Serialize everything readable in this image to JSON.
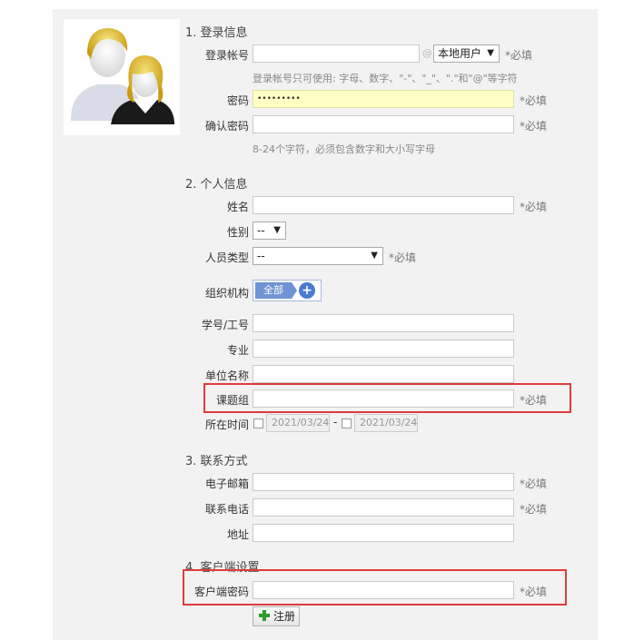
{
  "sections": {
    "login": "1. 登录信息",
    "personal": "2. 个人信息",
    "contact": "3. 联系方式",
    "client": "4. 客户端设置"
  },
  "login": {
    "account_label": "登录帐号",
    "at_symbol": "@",
    "domain_select": "本地用户",
    "account_hint": "登录帐号只可使用: 字母、数字、\"-\"、\"_\"、\".\"和\"@\"等字符",
    "password_label": "密码",
    "password_value": "•••••••••",
    "confirm_label": "确认密码",
    "password_hint": "8-24个字符，必须包含数字和大小写字母"
  },
  "personal": {
    "name_label": "姓名",
    "gender_label": "性别",
    "gender_value": "--",
    "type_label": "人员类型",
    "type_value": "--",
    "org_label": "组织机构",
    "org_all": "全部",
    "id_label": "学号/工号",
    "major_label": "专业",
    "unit_label": "单位名称",
    "group_label": "课题组",
    "time_label": "所在时间",
    "date_from": "2021/03/24",
    "date_sep": "-",
    "date_to": "2021/03/24"
  },
  "contact": {
    "email_label": "电子邮箱",
    "phone_label": "联系电话",
    "address_label": "地址"
  },
  "client": {
    "password_label": "客户端密码"
  },
  "required": "*必填",
  "register_button": "注册",
  "colors": {
    "highlight_border": "#e03a3a",
    "password_bg": "#ffffc4",
    "org_blue": "#6f93d4"
  },
  "icons": [
    "users-avatar-icon",
    "chevron-down-icon",
    "plus-circle-icon",
    "green-plus-icon"
  ]
}
